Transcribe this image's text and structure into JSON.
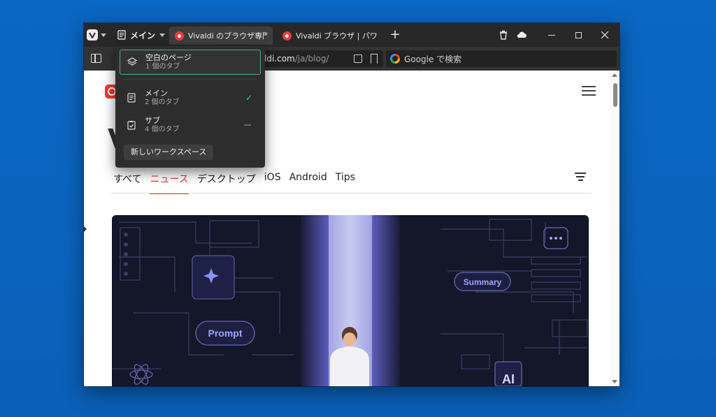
{
  "titlebar": {
    "workspace_button_label": "メイン",
    "tabs": [
      {
        "title": "Vivaldi のブラウザ専門ブログ -",
        "active": true
      },
      {
        "title": "Vivaldi ブラウザ | パワフル、パー",
        "active": false
      }
    ],
    "new_tab_label": "+"
  },
  "addressbar": {
    "url_visible": "ldi.com",
    "url_path": "/ja/blog/",
    "search_placeholder": "Google で検索"
  },
  "workspace_menu": {
    "items": [
      {
        "name": "空白のページ",
        "count": "1 個のタブ"
      },
      {
        "name": "メイン",
        "count": "2 個のタブ",
        "checked": true
      },
      {
        "name": "サブ",
        "count": "4 個のタブ"
      }
    ],
    "new_workspace_label": "新しいワークスペース"
  },
  "page": {
    "site_title_fragment": "V",
    "categories": [
      "すべて",
      "ニュース",
      "デスクトップ",
      "iOS",
      "Android",
      "Tips"
    ],
    "active_category": "ニュース",
    "hero_labels": {
      "prompt": "Prompt",
      "summary": "Summary",
      "ai": "AI"
    }
  },
  "colors": {
    "desktop": "#0a66c2",
    "titlebar": "#282828",
    "accent_red": "#e0363a",
    "workspace_active_border": "#4caf7d",
    "hero_bg": "#141629",
    "hero_light": "#9fa4ff"
  }
}
